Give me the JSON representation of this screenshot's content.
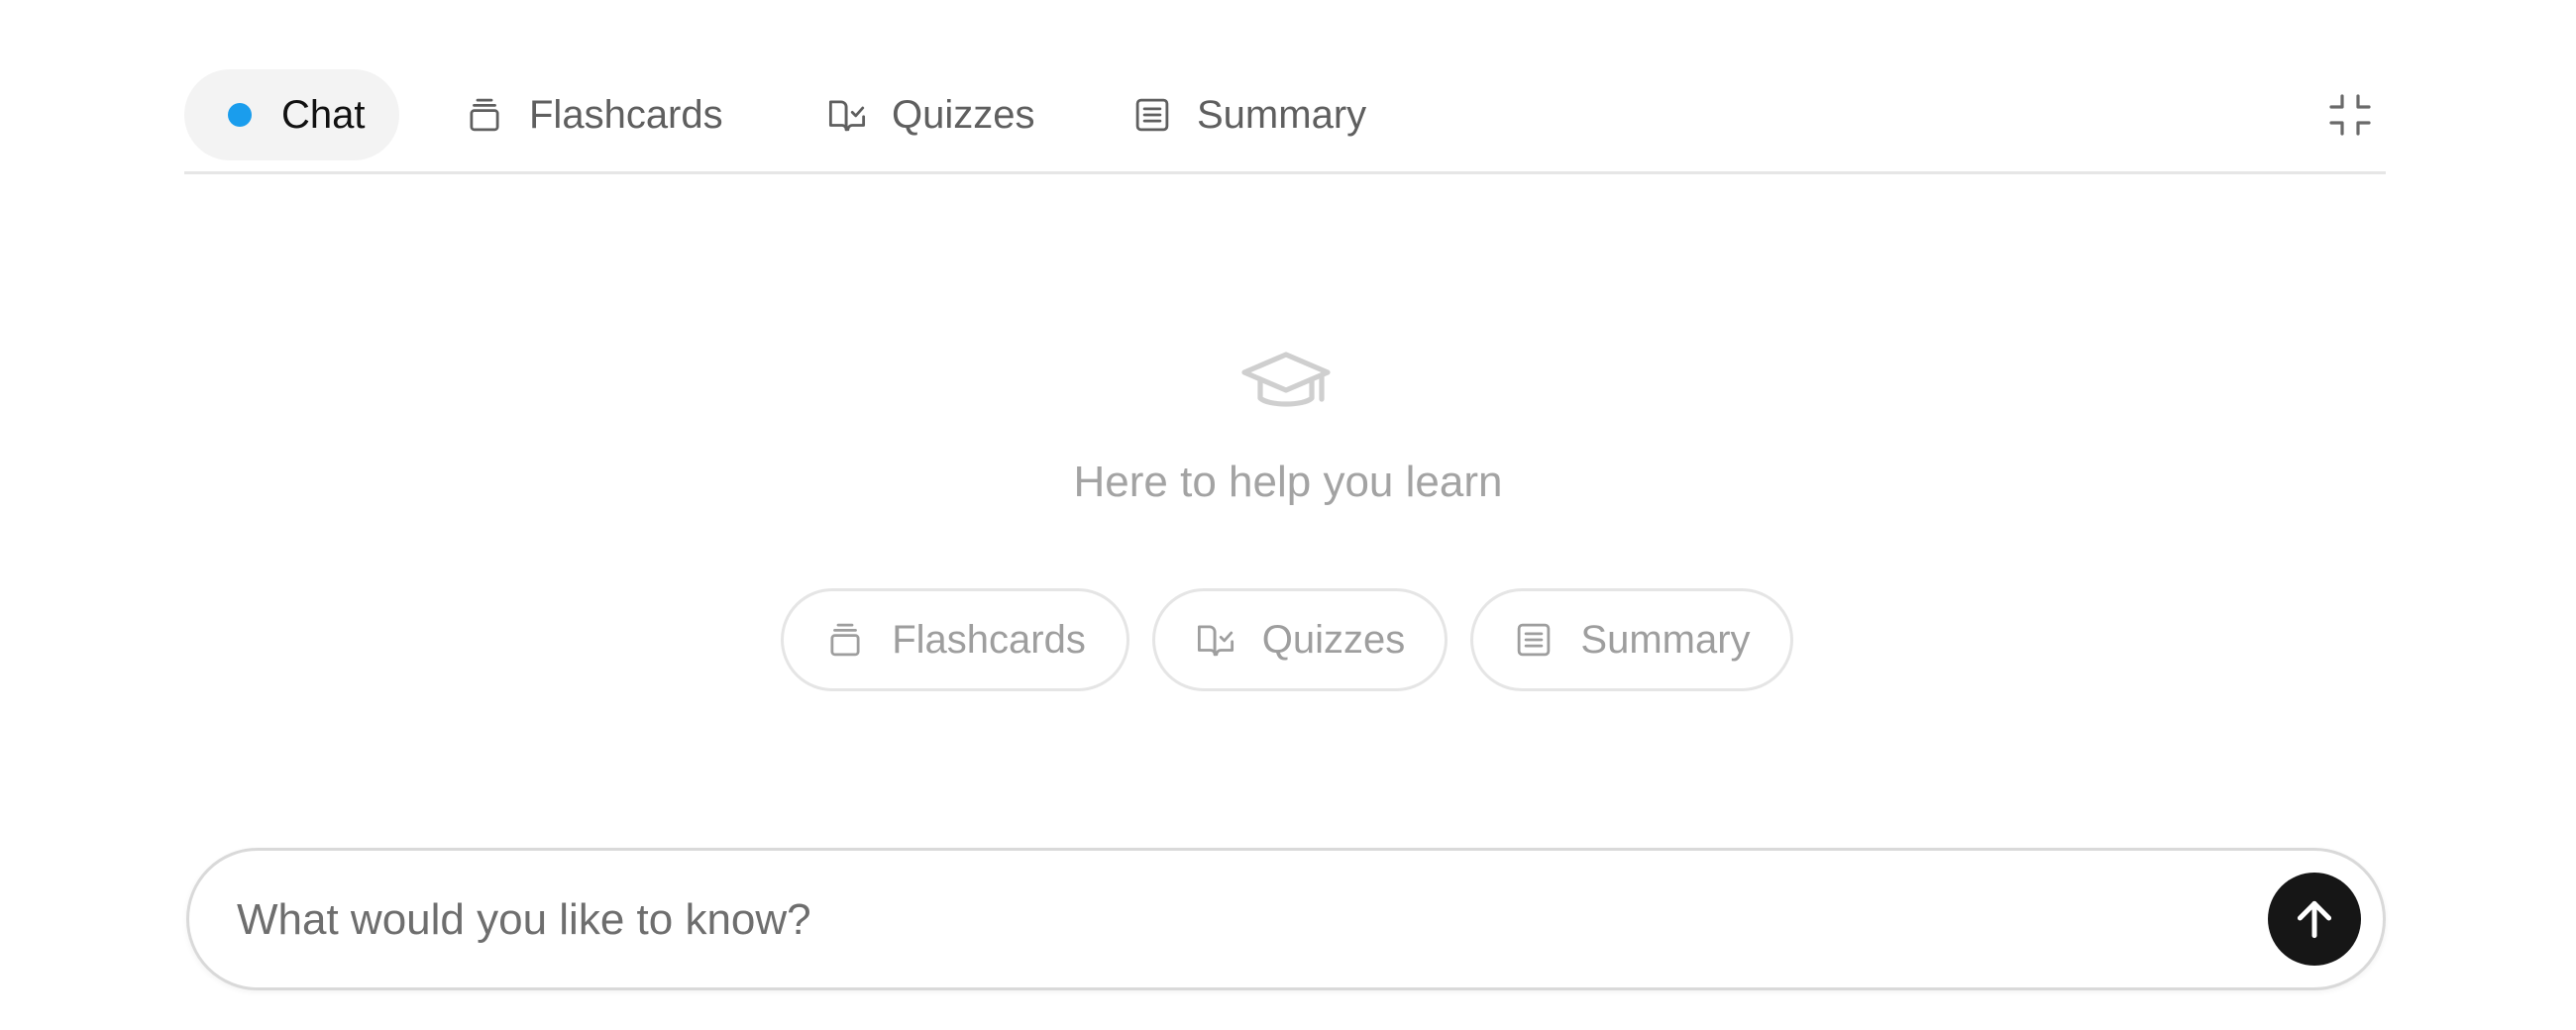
{
  "tabs": [
    {
      "label": "Chat",
      "icon": "status-dot",
      "active": true
    },
    {
      "label": "Flashcards",
      "icon": "cards-stack-icon",
      "active": false
    },
    {
      "label": "Quizzes",
      "icon": "book-check-icon",
      "active": false
    },
    {
      "label": "Summary",
      "icon": "document-lines-icon",
      "active": false
    }
  ],
  "header": {
    "collapse_icon": "minimize-icon"
  },
  "empty_state": {
    "icon": "graduation-cap-icon",
    "message": "Here to help you learn"
  },
  "chips": [
    {
      "label": "Flashcards",
      "icon": "cards-stack-icon"
    },
    {
      "label": "Quizzes",
      "icon": "book-check-icon"
    },
    {
      "label": "Summary",
      "icon": "document-lines-icon"
    }
  ],
  "composer": {
    "placeholder": "What would you like to know?",
    "value": "",
    "send_icon": "arrow-up-icon"
  },
  "colors": {
    "accent_dot": "#1a9ded",
    "send_button": "#161616",
    "active_tab_bg": "#f3f3f3"
  }
}
